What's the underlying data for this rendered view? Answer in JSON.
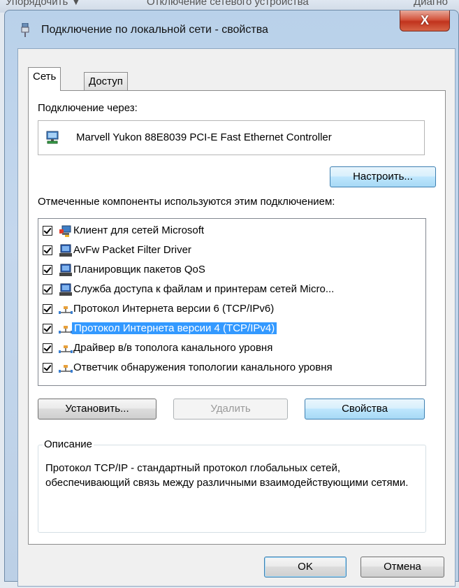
{
  "background_window": {
    "items": [
      "Упорядочить ▼",
      "Отключение сетевого устройства",
      "Диагно"
    ]
  },
  "window": {
    "title": "Подключение по локальной сети - свойства",
    "close_label": "X"
  },
  "tabs": [
    {
      "label": "Сеть",
      "active": true
    },
    {
      "label_first": "Д",
      "label_rest": "оступ",
      "active": false
    }
  ],
  "connect_via": {
    "label": "Подключение через:",
    "adapter": "Marvell Yukon 88E8039 PCI-E Fast Ethernet Controller",
    "configure_button": "Настроить..."
  },
  "components": {
    "label": "Отмеченные компоненты используются этим подключением:",
    "items": [
      {
        "label": "Клиент для сетей Microsoft",
        "checked": true,
        "icon": "network-client-icon"
      },
      {
        "label": "AvFw Packet Filter Driver",
        "checked": true,
        "icon": "network-service-icon"
      },
      {
        "label": "Планировщик пакетов QoS",
        "checked": true,
        "icon": "network-service-icon"
      },
      {
        "label": "Служба доступа к файлам и принтерам сетей Micro...",
        "checked": true,
        "icon": "network-service-icon"
      },
      {
        "label": "Протокол Интернета версии 6 (TCP/IPv6)",
        "checked": true,
        "icon": "protocol-icon"
      },
      {
        "label": "Протокол Интернета версии 4 (TCP/IPv4)",
        "checked": true,
        "icon": "protocol-icon",
        "selected": true
      },
      {
        "label": "Драйвер в/в тополога канального уровня",
        "checked": true,
        "icon": "protocol-icon"
      },
      {
        "label": "Ответчик обнаружения топологии канального уровня",
        "checked": true,
        "icon": "protocol-icon"
      }
    ]
  },
  "actions": {
    "install": "Установить...",
    "remove": "Удалить",
    "properties": "Свойства"
  },
  "description": {
    "legend": "Описание",
    "text": "Протокол TCP/IP - стандартный протокол глобальных сетей, обеспечивающий связь между различными взаимодействующими сетями."
  },
  "footer": {
    "ok": "OK",
    "cancel": "Отмена"
  },
  "colors": {
    "selection": "#3399ff",
    "close_button": "#c1331d",
    "titlebar": "#b9d1ea"
  }
}
